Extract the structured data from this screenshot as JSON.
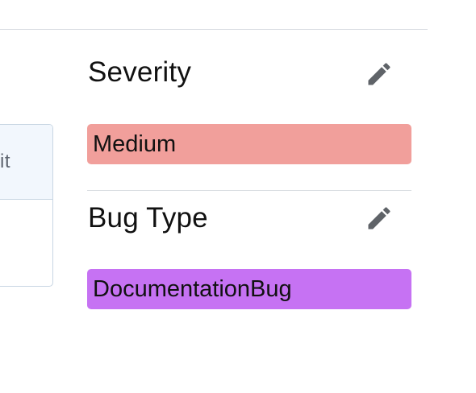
{
  "left_card": {
    "header_fragment": "it"
  },
  "severity": {
    "title": "Severity",
    "value": "Medium",
    "color": "#f19f9b",
    "edit_icon": "pencil-icon"
  },
  "bug_type": {
    "title": "Bug Type",
    "value": "DocumentationBug",
    "color": "#c672f3",
    "edit_icon": "pencil-icon"
  }
}
